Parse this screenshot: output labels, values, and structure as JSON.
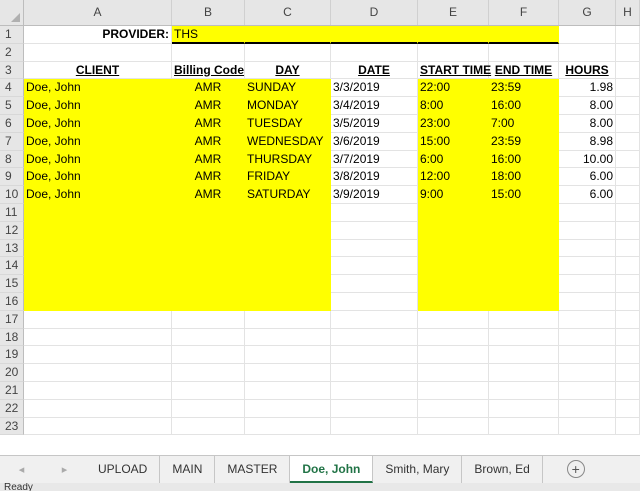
{
  "columns": [
    "A",
    "B",
    "C",
    "D",
    "E",
    "F",
    "G",
    "H"
  ],
  "provider": {
    "label": "PROVIDER:",
    "value": "THS"
  },
  "headers": {
    "client": "CLIENT",
    "billing": "Billing Code",
    "day": "DAY",
    "date": "DATE",
    "start": "START TIME",
    "end": "END TIME",
    "hours": "HOURS"
  },
  "rows": [
    {
      "client": "Doe, John",
      "billing": "AMR",
      "day": "SUNDAY",
      "date": "3/3/2019",
      "start": "22:00",
      "end": "23:59",
      "hours": "1.98"
    },
    {
      "client": "Doe, John",
      "billing": "AMR",
      "day": "MONDAY",
      "date": "3/4/2019",
      "start": "8:00",
      "end": "16:00",
      "hours": "8.00"
    },
    {
      "client": "Doe, John",
      "billing": "AMR",
      "day": "TUESDAY",
      "date": "3/5/2019",
      "start": "23:00",
      "end": "7:00",
      "hours": "8.00"
    },
    {
      "client": "Doe, John",
      "billing": "AMR",
      "day": "WEDNESDAY",
      "date": "3/6/2019",
      "start": "15:00",
      "end": "23:59",
      "hours": "8.98"
    },
    {
      "client": "Doe, John",
      "billing": "AMR",
      "day": "THURSDAY",
      "date": "3/7/2019",
      "start": "6:00",
      "end": "16:00",
      "hours": "10.00"
    },
    {
      "client": "Doe, John",
      "billing": "AMR",
      "day": "FRIDAY",
      "date": "3/8/2019",
      "start": "12:00",
      "end": "18:00",
      "hours": "6.00"
    },
    {
      "client": "Doe, John",
      "billing": "AMR",
      "day": "SATURDAY",
      "date": "3/9/2019",
      "start": "9:00",
      "end": "15:00",
      "hours": "6.00"
    }
  ],
  "row_numbers": [
    "1",
    "2",
    "3",
    "4",
    "5",
    "6",
    "7",
    "8",
    "9",
    "10",
    "11",
    "12",
    "13",
    "14",
    "15",
    "16",
    "17",
    "18",
    "19",
    "20",
    "21",
    "22",
    "23"
  ],
  "tabs": [
    "UPLOAD",
    "MAIN",
    "MASTER",
    "Doe, John",
    "Smith, Mary",
    "Brown, Ed"
  ],
  "active_tab": "Doe, John",
  "nav": {
    "prev": "◂",
    "next": "▸",
    "add": "+"
  },
  "status": "Ready",
  "colors": {
    "highlight": "#ffff00",
    "active_tab": "#217346"
  }
}
